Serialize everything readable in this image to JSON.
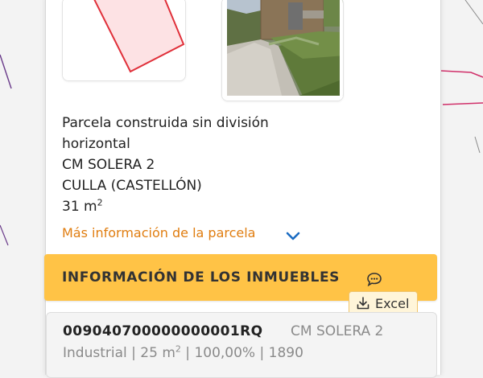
{
  "parcel": {
    "type_line1": "Parcela construida sin división",
    "type_line2": "horizontal",
    "address": "CM SOLERA 2",
    "municipality": "CULLA (CASTELLÓN)",
    "area_value": "31 m",
    "area_unit_sup": "2",
    "more_info_link": "Más información de la parcela"
  },
  "section": {
    "title": "INFORMACIÓN DE LOS INMUEBLES",
    "excel_label": "Excel"
  },
  "property": {
    "reference": "009040700000000001RQ",
    "address": "CM SOLERA 2",
    "use": "Industrial",
    "sep1": " | ",
    "area": "25 m",
    "area_unit_sup": "2",
    "sep2": " | ",
    "participation": "100,00%",
    "sep3": " | ",
    "year": "1890"
  },
  "colors": {
    "accent_orange": "#e07d10",
    "section_header_bg": "#ffc346",
    "chevron_blue": "#1a6bc2",
    "parcel_outline": "#e0303a"
  },
  "icons": {
    "chevron": "chevron-down-icon",
    "chat": "chat-bubble-icon",
    "download": "download-icon"
  }
}
